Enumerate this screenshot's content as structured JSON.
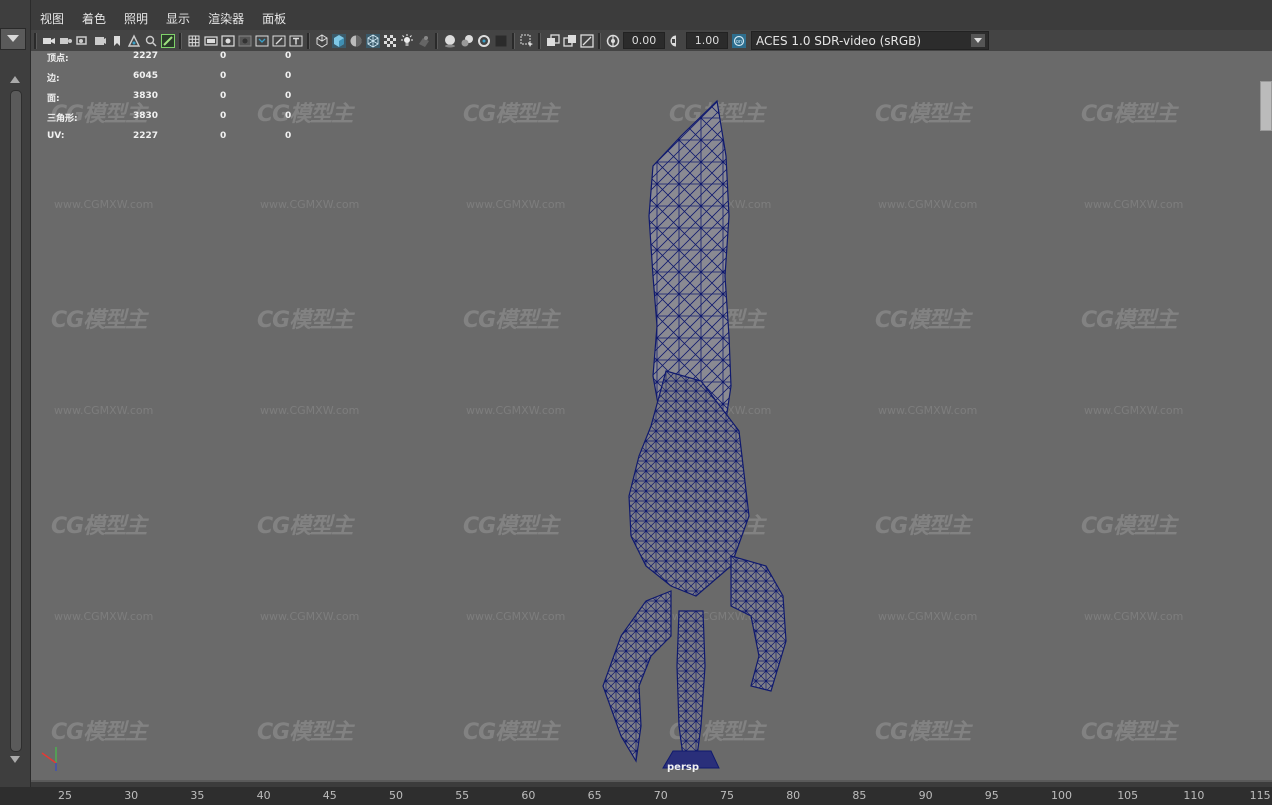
{
  "menu": [
    "视图",
    "着色",
    "照明",
    "显示",
    "渲染器",
    "面板"
  ],
  "toolbar": {
    "exposure": "0.00",
    "gamma": "1.00",
    "color_space": "ACES 1.0 SDR-video (sRGB)"
  },
  "hud": {
    "rows": [
      {
        "label": "顶点:",
        "v1": "2227",
        "v2": "0",
        "v3": "0"
      },
      {
        "label": "边:",
        "v1": "6045",
        "v2": "0",
        "v3": "0"
      },
      {
        "label": "面:",
        "v1": "3830",
        "v2": "0",
        "v3": "0"
      },
      {
        "label": "三角形:",
        "v1": "3830",
        "v2": "0",
        "v3": "0"
      },
      {
        "label": "UV:",
        "v1": "2227",
        "v2": "0",
        "v3": "0"
      }
    ]
  },
  "camera_label": "persp",
  "watermark": {
    "logo": "CG模型主",
    "url": "www.CGMXW.com"
  },
  "timeline_ticks": [
    "25",
    "30",
    "35",
    "40",
    "45",
    "50",
    "55",
    "60",
    "65",
    "70",
    "75",
    "80",
    "85",
    "90",
    "95",
    "100",
    "105",
    "110",
    "115"
  ],
  "colors": {
    "viewport_bg": "#6a6a6a",
    "wireframe": "#101a6e",
    "mesh_fill": "#8a8a92",
    "accent_teal": "#3aa0c8"
  }
}
